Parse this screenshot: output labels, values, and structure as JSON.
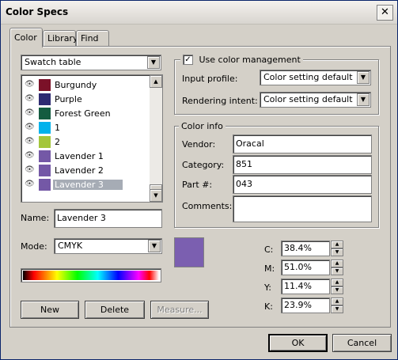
{
  "window": {
    "title": "Color Specs",
    "close_glyph": "✕"
  },
  "tabs": [
    {
      "label": "Color"
    },
    {
      "label": "Library"
    },
    {
      "label": "Find"
    }
  ],
  "swatch_source": {
    "selected": "Swatch table"
  },
  "swatches": [
    {
      "name": "Burgundy",
      "color": "#7b1128"
    },
    {
      "name": "Purple",
      "color": "#2e2a72"
    },
    {
      "name": "Forest Green",
      "color": "#145c40"
    },
    {
      "name": "1",
      "color": "#00b2ec"
    },
    {
      "name": "2",
      "color": "#a4c63a"
    },
    {
      "name": "Lavender 1",
      "color": "#7458a6"
    },
    {
      "name": "Lavender 2",
      "color": "#7458a6"
    },
    {
      "name": "Lavender 3",
      "color": "#7458a6"
    }
  ],
  "name_field": {
    "label": "Name:",
    "value": "Lavender 3"
  },
  "mode_field": {
    "label": "Mode:",
    "value": "CMYK"
  },
  "buttons": {
    "new": "New",
    "delete": "Delete",
    "measure": "Measure...",
    "ok": "OK",
    "cancel": "Cancel"
  },
  "color_management": {
    "checkbox_label": "Use color management",
    "checked": true,
    "check_glyph": "✓",
    "input_profile_label": "Input profile:",
    "input_profile_value": "Color setting default",
    "rendering_intent_label": "Rendering intent:",
    "rendering_intent_value": "Color setting default"
  },
  "color_info": {
    "title": "Color info",
    "vendor_label": "Vendor:",
    "vendor_value": "Oracal",
    "category_label": "Category:",
    "category_value": "851",
    "part_label": "Part #:",
    "part_value": "043",
    "comments_label": "Comments:",
    "comments_value": ""
  },
  "preview_color": "#7b5fb0",
  "cmyk": [
    {
      "label": "C:",
      "value": "38.4%"
    },
    {
      "label": "M:",
      "value": "51.0%"
    },
    {
      "label": "Y:",
      "value": "11.4%"
    },
    {
      "label": "K:",
      "value": "23.9%"
    }
  ],
  "icons": {
    "eye": "👁",
    "dropdown_arrow": "▼",
    "scroll_up": "▲",
    "scroll_down": "▼",
    "spin_up": "▲",
    "spin_down": "▼"
  }
}
